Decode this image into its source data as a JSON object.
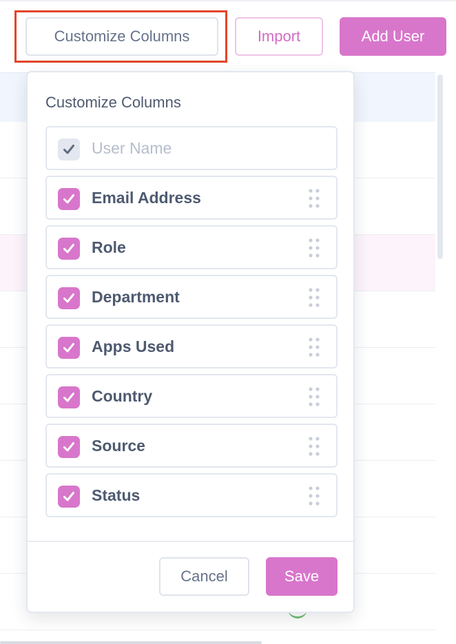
{
  "toolbar": {
    "customize_label": "Customize Columns",
    "import_label": "Import",
    "add_user_label": "Add User"
  },
  "popover": {
    "title": "Customize Columns",
    "columns": [
      {
        "label": "User Name",
        "checked": true,
        "locked": true
      },
      {
        "label": "Email Address",
        "checked": true,
        "locked": false
      },
      {
        "label": "Role",
        "checked": true,
        "locked": false
      },
      {
        "label": "Department",
        "checked": true,
        "locked": false
      },
      {
        "label": "Apps Used",
        "checked": true,
        "locked": false
      },
      {
        "label": "Country",
        "checked": true,
        "locked": false
      },
      {
        "label": "Source",
        "checked": true,
        "locked": false
      },
      {
        "label": "Status",
        "checked": true,
        "locked": false
      }
    ],
    "cancel_label": "Cancel",
    "save_label": "Save"
  },
  "colors": {
    "accent": "#d876cb",
    "highlight_border": "#e2452a",
    "text": "#4e5a70",
    "disabled_text": "#b6bdca"
  },
  "icons": {
    "check": "check-icon",
    "drag": "drag-handle-icon"
  }
}
